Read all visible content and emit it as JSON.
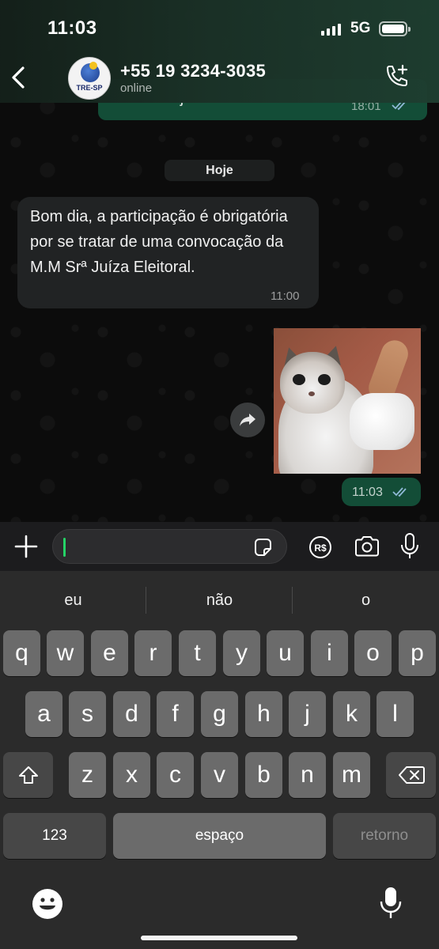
{
  "status_bar": {
    "time": "11:03",
    "network": "5G"
  },
  "header": {
    "contact_name": "+55 19 3234-3035",
    "contact_status": "online",
    "avatar_text": "TRE-SP"
  },
  "messages": {
    "previous_outgoing": {
      "text": "sem uma justificativa?",
      "time": "18:01",
      "status": "read"
    },
    "day_separator": "Hoje",
    "incoming": {
      "text": "Bom dia, a participação é obrigatória por se tratar de uma convocação da M.M Srª Juíza Eleitoral.",
      "time": "11:00"
    },
    "outgoing_sticker": {
      "description_icon": "cat-thumbs-up-sticker",
      "time": "11:03",
      "status": "read"
    }
  },
  "input_bar": {
    "placeholder": ""
  },
  "keyboard": {
    "suggestions": [
      "eu",
      "não",
      "o"
    ],
    "row1": [
      "q",
      "w",
      "e",
      "r",
      "t",
      "y",
      "u",
      "i",
      "o",
      "p"
    ],
    "row2": [
      "a",
      "s",
      "d",
      "f",
      "g",
      "h",
      "j",
      "k",
      "l"
    ],
    "row3": [
      "z",
      "x",
      "c",
      "v",
      "b",
      "n",
      "m"
    ],
    "numbers_key": "123",
    "space_key": "espaço",
    "return_key": "retorno"
  },
  "colors": {
    "outgoing_bubble": "#134d37",
    "incoming_bubble": "#212324",
    "accent": "#25d366",
    "read_tick": "#8fb9d6"
  }
}
